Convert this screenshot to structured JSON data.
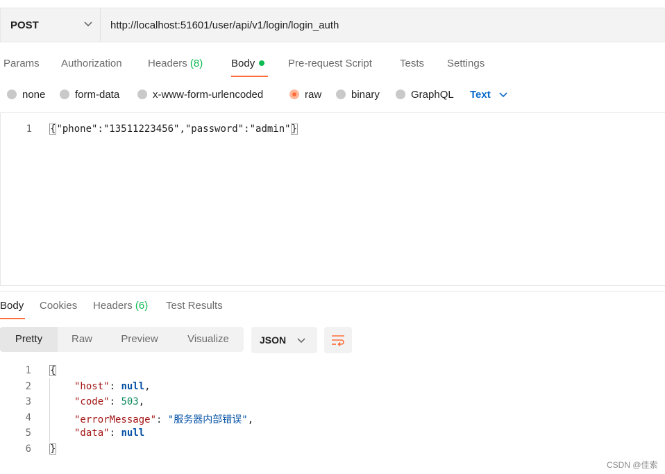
{
  "request": {
    "method": "POST",
    "url": "http://localhost:51601/user/api/v1/login/login_auth"
  },
  "request_tabs": {
    "params": "Params",
    "authorization": "Authorization",
    "headers": "Headers",
    "headers_count": "(8)",
    "body": "Body",
    "pre_request": "Pre-request Script",
    "tests": "Tests",
    "settings": "Settings"
  },
  "body_types": {
    "none": "none",
    "form_data": "form-data",
    "urlencoded": "x-www-form-urlencoded",
    "raw": "raw",
    "binary": "binary",
    "graphql": "GraphQL",
    "selected": "raw",
    "raw_type": "Text"
  },
  "request_body": {
    "line_number": "1",
    "code": "{\"phone\":\"13511223456\",\"password\":\"admin\"}",
    "code_inner": "\"phone\":\"13511223456\",\"password\":\"admin\"",
    "open_brace": "{",
    "close_brace": "}"
  },
  "response_tabs": {
    "body": "Body",
    "cookies": "Cookies",
    "headers": "Headers",
    "headers_count": "(6)",
    "test_results": "Test Results"
  },
  "view_modes": {
    "pretty": "Pretty",
    "raw": "Raw",
    "preview": "Preview",
    "visualize": "Visualize",
    "selected": "Pretty"
  },
  "format": "JSON",
  "response_lines": {
    "l1": {
      "num": "1",
      "text": "{"
    },
    "l2": {
      "num": "2",
      "key": "\"host\"",
      "sep": ": ",
      "value": "null",
      "end": ","
    },
    "l3": {
      "num": "3",
      "key": "\"code\"",
      "sep": ": ",
      "value": "503",
      "end": ","
    },
    "l4": {
      "num": "4",
      "key": "\"errorMessage\"",
      "sep": ": ",
      "value": "\"服务器内部错误\"",
      "end": ","
    },
    "l5": {
      "num": "5",
      "key": "\"data\"",
      "sep": ": ",
      "value": "null",
      "end": ""
    },
    "l6": {
      "num": "6",
      "text": "}"
    }
  },
  "watermark": "CSDN @佳索",
  "colors": {
    "accent_orange": "#ff6c37",
    "green": "#0cbb52",
    "link_blue": "#0b6bcb"
  }
}
